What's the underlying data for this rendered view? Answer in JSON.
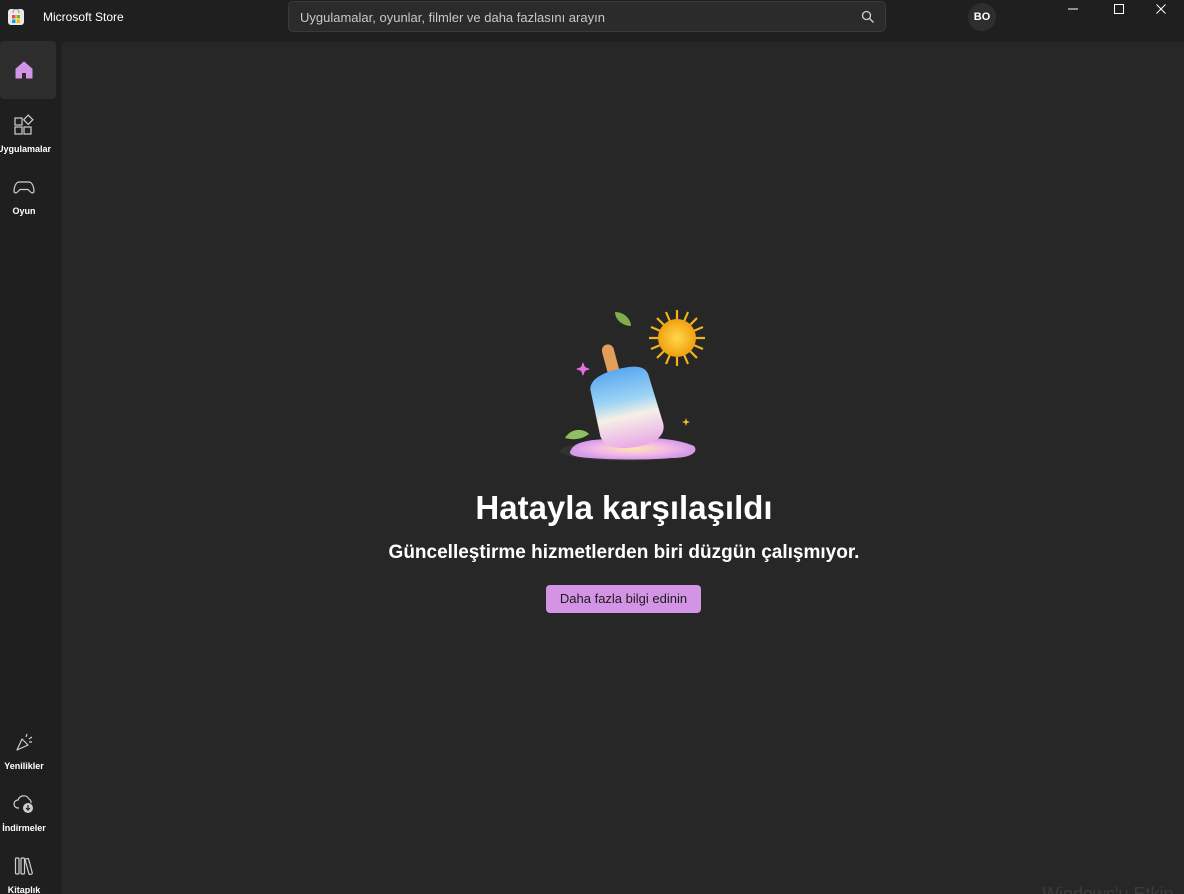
{
  "window": {
    "title": "Microsoft Store"
  },
  "search": {
    "placeholder": "Uygulamalar, oyunlar, filmler ve daha fazlasını arayın"
  },
  "account": {
    "initials": "BO"
  },
  "sidebar": {
    "items": [
      {
        "label": "",
        "icon": "home-icon",
        "active": true
      },
      {
        "label": "Uygulamalar",
        "icon": "apps-icon"
      },
      {
        "label": "Oyun",
        "icon": "gamepad-icon"
      },
      {
        "label": "Yenilikler",
        "icon": "whats-new-icon"
      },
      {
        "label": "İndirmeler",
        "icon": "downloads-icon"
      },
      {
        "label": "Kitaplık",
        "icon": "library-icon"
      }
    ]
  },
  "error": {
    "title": "Hatayla karşılaşıldı",
    "subtitle": "Güncelleştirme hizmetlerden biri düzgün çalışmıyor.",
    "button_label": "Daha fazla bilgi edinin"
  },
  "watermark": {
    "text": "Windows'u Etkin"
  },
  "colors": {
    "accent": "#d494e6",
    "background": "#1f1f1f",
    "content_background": "#272727"
  }
}
